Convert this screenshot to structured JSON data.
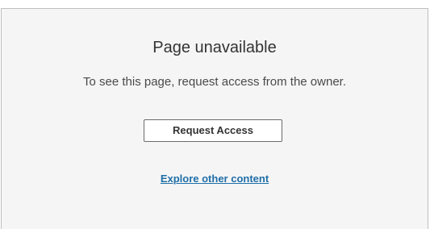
{
  "page": {
    "title": "Page unavailable",
    "message": "To see this page, request access from the owner."
  },
  "actions": {
    "request_access_label": "Request Access",
    "explore_link_label": "Explore other content"
  },
  "colors": {
    "link": "#1f6fa8",
    "panel_background": "#f5f5f5",
    "border": "#bfbfbf"
  }
}
